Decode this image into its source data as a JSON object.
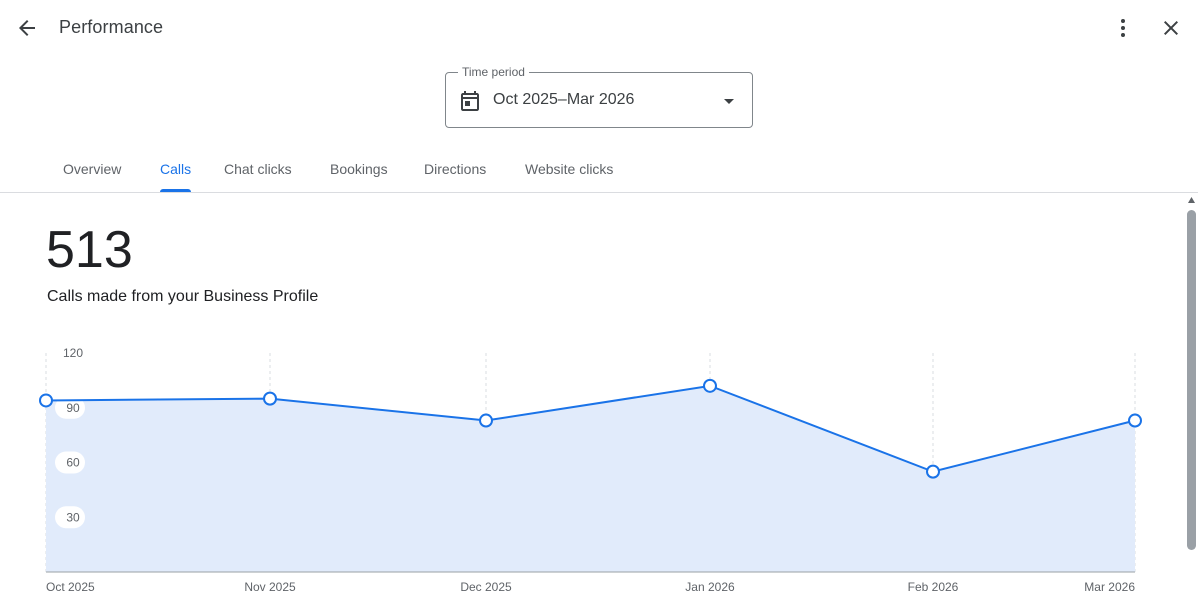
{
  "header": {
    "title": "Performance",
    "back_icon": "arrow-back-icon",
    "more_icon": "more-vert-icon",
    "close_icon": "close-icon"
  },
  "time_period": {
    "label": "Time period",
    "value": "Oct 2025–Mar 2026",
    "icon": "calendar-icon"
  },
  "tabs": [
    {
      "label": "Overview",
      "active": false
    },
    {
      "label": "Calls",
      "active": true
    },
    {
      "label": "Chat clicks",
      "active": false
    },
    {
      "label": "Bookings",
      "active": false
    },
    {
      "label": "Directions",
      "active": false
    },
    {
      "label": "Website clicks",
      "active": false
    }
  ],
  "summary": {
    "total": "513",
    "description": "Calls made from your Business Profile"
  },
  "colors": {
    "accent": "#1a73e8",
    "area_fill": "#e1ebfb"
  },
  "chart_data": {
    "type": "area",
    "categories": [
      "Oct 2025",
      "Nov 2025",
      "Dec 2025",
      "Jan 2026",
      "Feb 2026",
      "Mar 2026"
    ],
    "values": [
      94,
      95,
      83,
      102,
      55,
      83
    ],
    "yticks": [
      "30",
      "60",
      "90",
      "120"
    ],
    "ylim": [
      0,
      120
    ],
    "grid": "vertical dashed",
    "xlabel": "",
    "ylabel": ""
  }
}
